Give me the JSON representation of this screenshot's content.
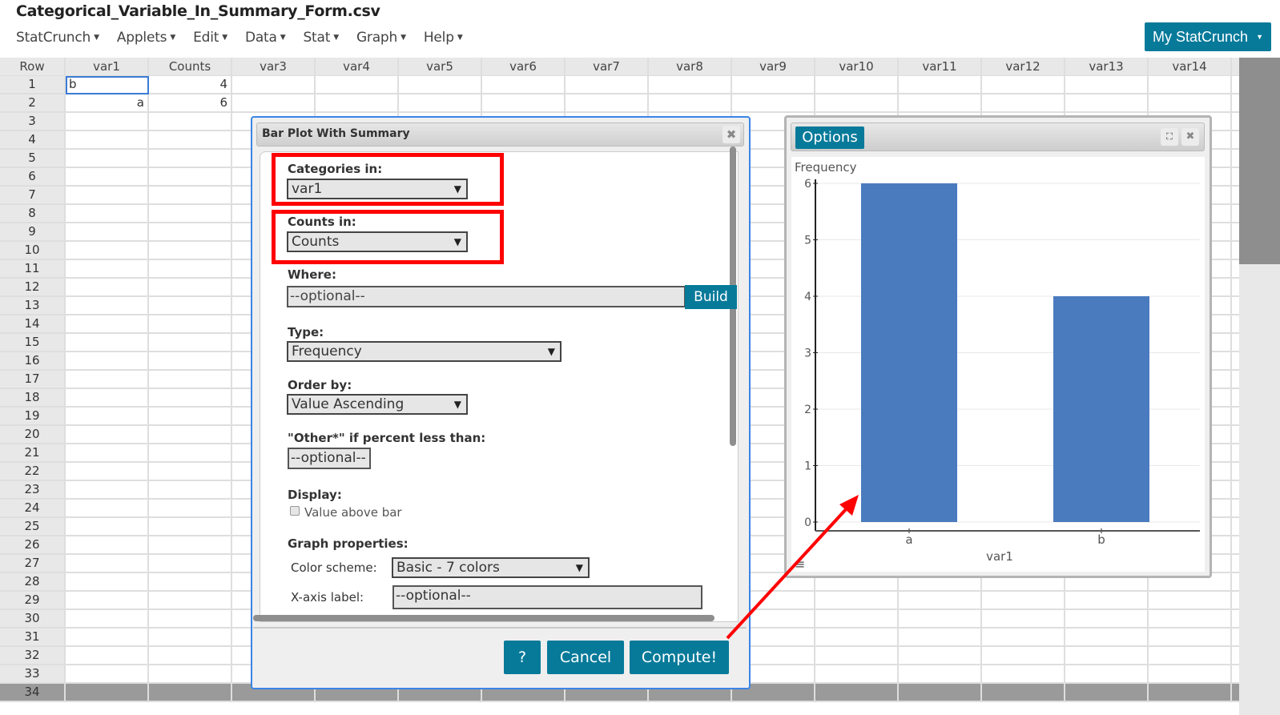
{
  "header": {
    "file_title": "Categorical_Variable_In_Summary_Form.csv",
    "menu": [
      {
        "label": "StatCrunch"
      },
      {
        "label": "Applets"
      },
      {
        "label": "Edit"
      },
      {
        "label": "Data"
      },
      {
        "label": "Stat"
      },
      {
        "label": "Graph"
      },
      {
        "label": "Help"
      }
    ],
    "account_button": "My StatCrunch"
  },
  "grid": {
    "row_header": "Row",
    "columns": [
      "var1",
      "Counts",
      "var3",
      "var4",
      "var5",
      "var6",
      "var7",
      "var8",
      "var9",
      "var10",
      "var11",
      "var12",
      "var13",
      "var14"
    ],
    "rows": [
      {
        "num": "1",
        "var1": "b",
        "Counts": "4"
      },
      {
        "num": "2",
        "var1": "a",
        "Counts": "6"
      }
    ],
    "visible_row_count": 34,
    "selected_cell": {
      "row": 1,
      "column": "var1"
    }
  },
  "dialog": {
    "title": "Bar Plot With Summary",
    "categories_label": "Categories in:",
    "categories_value": "var1",
    "counts_label": "Counts in:",
    "counts_value": "Counts",
    "where_label": "Where:",
    "where_placeholder": "--optional--",
    "build_label": "Build",
    "type_label": "Type:",
    "type_value": "Frequency",
    "order_label": "Order by:",
    "order_value": "Value Ascending",
    "other_label": "\"Other*\" if percent less than:",
    "other_placeholder": "--optional--",
    "display_label": "Display:",
    "value_above_bar_label": "Value above bar",
    "value_above_bar_checked": false,
    "graph_props_label": "Graph properties:",
    "color_scheme_label": "Color scheme:",
    "color_scheme_value": "Basic - 7 colors",
    "xaxis_label_label": "X-axis label:",
    "xaxis_label_placeholder": "--optional--",
    "help_button": "?",
    "cancel_button": "Cancel",
    "compute_button": "Compute!"
  },
  "chart_window": {
    "options_button": "Options"
  },
  "chart_data": {
    "type": "bar",
    "categories": [
      "a",
      "b"
    ],
    "values": [
      6,
      4
    ],
    "title": "",
    "xlabel": "var1",
    "ylabel": "Frequency",
    "ylim": [
      0,
      6
    ],
    "yticks": [
      0,
      1,
      2,
      3,
      4,
      5,
      6
    ],
    "grid": true,
    "bar_color": "#4a7bbf"
  },
  "colors": {
    "accent": "#077a9a",
    "highlight_box": "#ff0000",
    "dialog_border": "#3a85e6"
  }
}
